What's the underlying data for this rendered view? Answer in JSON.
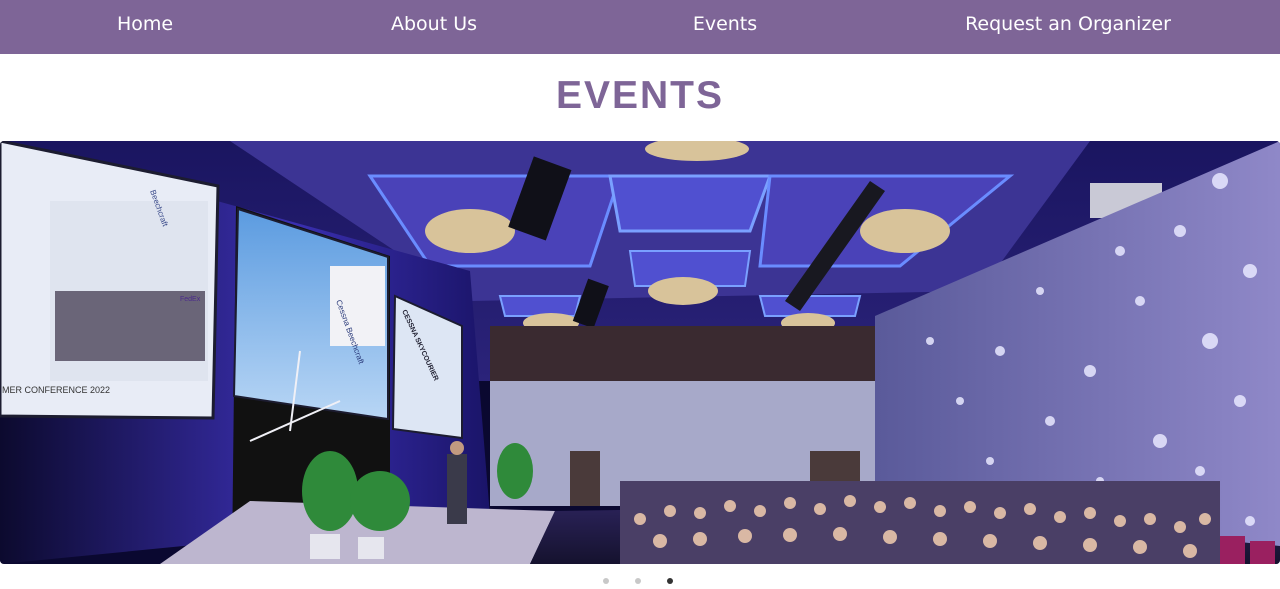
{
  "nav": {
    "items": [
      {
        "label": "Home"
      },
      {
        "label": "About Us"
      },
      {
        "label": "Events"
      },
      {
        "label": "Request an Organizer"
      }
    ]
  },
  "page": {
    "title": "EVENTS"
  },
  "carousel": {
    "slide": {
      "screen_left_text": "MER CONFERENCE 2022",
      "screen_left_brand": "Beechcraft",
      "screen_mid_brand": "Cessna  Beechcraft",
      "screen_right_heading": "CESSNA SKYCOURIER",
      "screen_right_brand": "FedEx"
    },
    "slide_count": 3,
    "active_index": 2
  },
  "colors": {
    "accent": "#7e6597",
    "nav_text": "#ffffff",
    "dot_inactive": "#c8c8c8",
    "dot_active": "#333333"
  }
}
